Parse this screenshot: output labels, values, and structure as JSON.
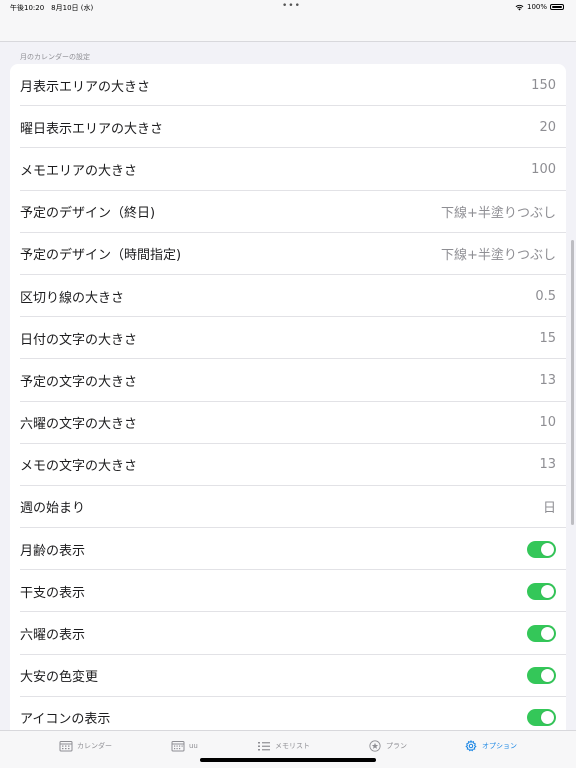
{
  "status_bar": {
    "time": "午後10:20　8月10日 (水)",
    "dots": "•••",
    "battery_label": "100%"
  },
  "section_header": "月のカレンダーの設定",
  "rows": [
    {
      "label": "月表示エリアの大きさ",
      "value": "150"
    },
    {
      "label": "曜日表示エリアの大きさ",
      "value": "20"
    },
    {
      "label": "メモエリアの大きさ",
      "value": "100"
    },
    {
      "label": "予定のデザイン（終日)",
      "value": "下線+半塗りつぶし"
    },
    {
      "label": "予定のデザイン（時間指定)",
      "value": "下線+半塗りつぶし"
    },
    {
      "label": "区切り線の大きさ",
      "value": "0.5"
    },
    {
      "label": "日付の文字の大きさ",
      "value": "15"
    },
    {
      "label": "予定の文字の大きさ",
      "value": "13"
    },
    {
      "label": "六曜の文字の大きさ",
      "value": "10"
    },
    {
      "label": "メモの文字の大きさ",
      "value": "13"
    },
    {
      "label": "週の始まり",
      "value": "日"
    }
  ],
  "toggles": [
    {
      "label": "月齢の表示",
      "on": true
    },
    {
      "label": "干支の表示",
      "on": true
    },
    {
      "label": "六曜の表示",
      "on": true
    },
    {
      "label": "大安の色変更",
      "on": true
    },
    {
      "label": "アイコンの表示",
      "on": true
    }
  ],
  "tabs": [
    {
      "label": "カレンダー",
      "icon": "calendar-icon",
      "active": false
    },
    {
      "label": "uu",
      "icon": "calendar-grid-icon",
      "active": false
    },
    {
      "label": "メモリスト",
      "icon": "list-icon",
      "active": false
    },
    {
      "label": "プラン",
      "icon": "star-icon",
      "active": false
    },
    {
      "label": "オプション",
      "icon": "gear-icon",
      "active": true
    }
  ],
  "colors": {
    "accent": "#1e88e5",
    "toggle_on": "#34c759",
    "secondary_text": "#8e8e93"
  }
}
